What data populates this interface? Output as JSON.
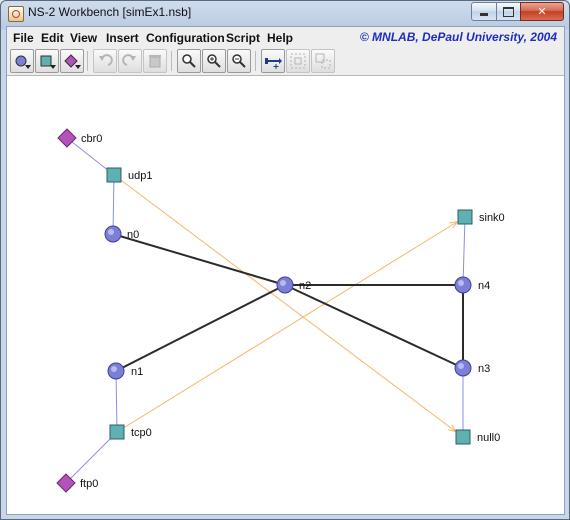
{
  "window": {
    "title": "NS-2 Workbench [simEx1.nsb]",
    "close_glyph": "✕"
  },
  "menubar": {
    "items": [
      "File",
      "Edit",
      "View",
      "Insert",
      "Configuration",
      "Script",
      "Help"
    ],
    "brand": "© MNLAB, DePaul University, 2004"
  },
  "toolbar": {
    "buttons": [
      {
        "name": "node-tool",
        "icon": "circle-node-icon",
        "dropdown": true,
        "enabled": true
      },
      {
        "name": "agent-tool",
        "icon": "square-agent-icon",
        "dropdown": true,
        "enabled": true
      },
      {
        "name": "app-tool",
        "icon": "diamond-app-icon",
        "dropdown": true,
        "enabled": true
      },
      {
        "name": "undo",
        "icon": "undo-icon",
        "enabled": false
      },
      {
        "name": "redo",
        "icon": "redo-icon",
        "enabled": false
      },
      {
        "name": "delete",
        "icon": "trash-icon",
        "enabled": false
      },
      {
        "name": "zoom",
        "icon": "magnifier-icon",
        "enabled": true
      },
      {
        "name": "zoom-in",
        "icon": "zoom-in-icon",
        "enabled": true
      },
      {
        "name": "zoom-out",
        "icon": "zoom-out-icon",
        "enabled": true
      },
      {
        "name": "link-tool",
        "icon": "link-add-icon",
        "enabled": true
      },
      {
        "name": "group-tool",
        "icon": "group-icon",
        "enabled": false
      },
      {
        "name": "ungroup-tool",
        "icon": "ungroup-icon",
        "enabled": false
      }
    ]
  },
  "colors": {
    "node_fill": "#7b7fd6",
    "agent_fill": "#5eb1b0",
    "app_fill": "#b352b8",
    "link": "#2b2b2b",
    "attach": "#8a8ee8",
    "flow": "#f6b66a"
  },
  "topology": {
    "nodes": [
      {
        "id": "n0",
        "label": "n0",
        "type": "node"
      },
      {
        "id": "n1",
        "label": "n1",
        "type": "node"
      },
      {
        "id": "n2",
        "label": "n2",
        "type": "node"
      },
      {
        "id": "n3",
        "label": "n3",
        "type": "node"
      },
      {
        "id": "n4",
        "label": "n4",
        "type": "node"
      },
      {
        "id": "udp1",
        "label": "udp1",
        "type": "agent"
      },
      {
        "id": "tcp0",
        "label": "tcp0",
        "type": "agent"
      },
      {
        "id": "sink0",
        "label": "sink0",
        "type": "agent"
      },
      {
        "id": "null0",
        "label": "null0",
        "type": "agent"
      },
      {
        "id": "cbr0",
        "label": "cbr0",
        "type": "app"
      },
      {
        "id": "ftp0",
        "label": "ftp0",
        "type": "app"
      }
    ],
    "links": [
      [
        "n0",
        "n2"
      ],
      [
        "n1",
        "n2"
      ],
      [
        "n2",
        "n4"
      ],
      [
        "n2",
        "n3"
      ],
      [
        "n4",
        "n3"
      ]
    ],
    "attachments": [
      [
        "cbr0",
        "udp1"
      ],
      [
        "udp1",
        "n0"
      ],
      [
        "ftp0",
        "tcp0"
      ],
      [
        "tcp0",
        "n1"
      ],
      [
        "sink0",
        "n4"
      ],
      [
        "null0",
        "n3"
      ]
    ],
    "flows": [
      [
        "udp1",
        "null0"
      ],
      [
        "tcp0",
        "sink0"
      ]
    ]
  }
}
